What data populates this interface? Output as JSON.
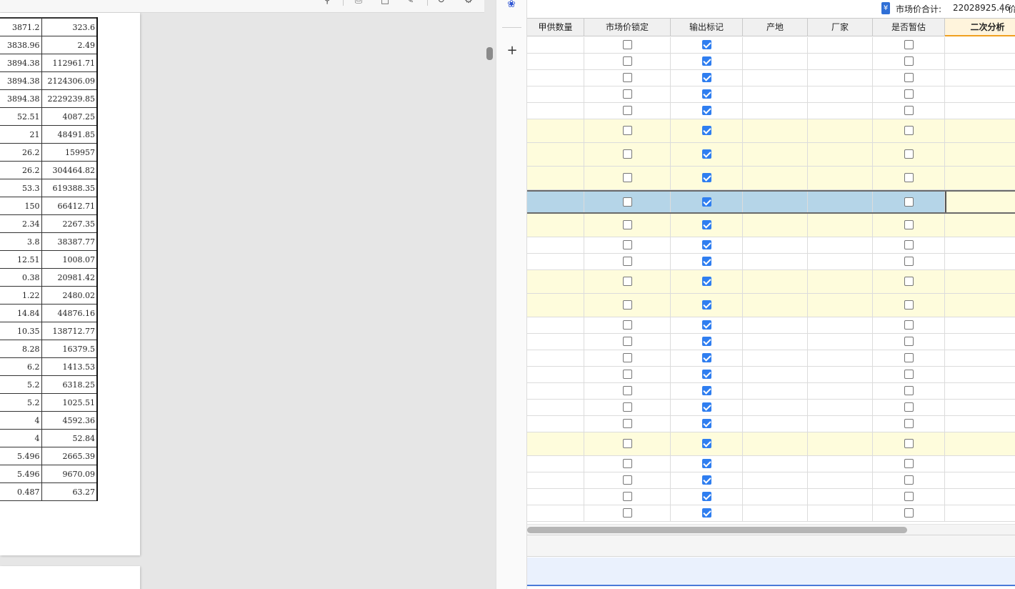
{
  "pdf_viewer": {
    "toolbar_icons": [
      "search-icon",
      "print-icon",
      "page-icon",
      "edit-icon",
      "rotate-icon",
      "settings-icon"
    ],
    "table_rows": [
      [
        "3871.2",
        "323.6"
      ],
      [
        "3838.96",
        "2.49"
      ],
      [
        "3894.38",
        "112961.71"
      ],
      [
        "3894.38",
        "2124306.09"
      ],
      [
        "3894.38",
        "2229239.85"
      ],
      [
        "52.51",
        "4087.25"
      ],
      [
        "21",
        "48491.85"
      ],
      [
        "26.2",
        "159957"
      ],
      [
        "26.2",
        "304464.82"
      ],
      [
        "53.3",
        "619388.35"
      ],
      [
        "150",
        "66412.71"
      ],
      [
        "2.34",
        "2267.35"
      ],
      [
        "3.8",
        "38387.77"
      ],
      [
        "12.51",
        "1008.07"
      ],
      [
        "0.38",
        "20981.42"
      ],
      [
        "1.22",
        "2480.02"
      ],
      [
        "14.84",
        "44876.16"
      ],
      [
        "10.35",
        "138712.77"
      ],
      [
        "8.28",
        "16379.5"
      ],
      [
        "6.2",
        "1413.53"
      ],
      [
        "5.2",
        "6318.25"
      ],
      [
        "5.2",
        "1025.51"
      ],
      [
        "4",
        "4592.36"
      ],
      [
        "4",
        "52.84"
      ],
      [
        "5.496",
        "2665.39"
      ],
      [
        "5.496",
        "9670.09"
      ],
      [
        "0.487",
        "63.27"
      ]
    ]
  },
  "rail": {
    "logo_icon": "paw-icon",
    "add_icon": "plus-icon",
    "add_label": "+"
  },
  "status": {
    "total_label": "市场价合计:",
    "total_value": "22028925.46",
    "next_label": "价",
    "currency_icon": "¥"
  },
  "grid": {
    "columns": [
      {
        "key": "jiagong_qty",
        "label": "甲供数量"
      },
      {
        "key": "price_lock",
        "label": "市场价锁定"
      },
      {
        "key": "output_flag",
        "label": "输出标记"
      },
      {
        "key": "origin",
        "label": "产地"
      },
      {
        "key": "manufacturer",
        "label": "厂家"
      },
      {
        "key": "provisional",
        "label": "是否暂估"
      },
      {
        "key": "secondary",
        "label": "二次分析"
      }
    ],
    "active_column": "二次分析",
    "rows": [
      {
        "style": "white",
        "price_lock": false,
        "output_flag": true,
        "provisional": false
      },
      {
        "style": "white",
        "price_lock": false,
        "output_flag": true,
        "provisional": false
      },
      {
        "style": "white",
        "price_lock": false,
        "output_flag": true,
        "provisional": false
      },
      {
        "style": "white",
        "price_lock": false,
        "output_flag": true,
        "provisional": false
      },
      {
        "style": "white",
        "price_lock": false,
        "output_flag": true,
        "provisional": false
      },
      {
        "style": "yellow",
        "price_lock": false,
        "output_flag": true,
        "provisional": false
      },
      {
        "style": "yellow",
        "price_lock": false,
        "output_flag": true,
        "provisional": false
      },
      {
        "style": "yellow",
        "price_lock": false,
        "output_flag": true,
        "provisional": false
      },
      {
        "style": "selected",
        "price_lock": false,
        "output_flag": true,
        "provisional": false
      },
      {
        "style": "yellow",
        "price_lock": false,
        "output_flag": true,
        "provisional": false
      },
      {
        "style": "white",
        "price_lock": false,
        "output_flag": true,
        "provisional": false
      },
      {
        "style": "white",
        "price_lock": false,
        "output_flag": true,
        "provisional": false
      },
      {
        "style": "yellow",
        "price_lock": false,
        "output_flag": true,
        "provisional": false
      },
      {
        "style": "yellow",
        "price_lock": false,
        "output_flag": true,
        "provisional": false
      },
      {
        "style": "white",
        "price_lock": false,
        "output_flag": true,
        "provisional": false
      },
      {
        "style": "white",
        "price_lock": false,
        "output_flag": true,
        "provisional": false
      },
      {
        "style": "white",
        "price_lock": false,
        "output_flag": true,
        "provisional": false
      },
      {
        "style": "white",
        "price_lock": false,
        "output_flag": true,
        "provisional": false
      },
      {
        "style": "white",
        "price_lock": false,
        "output_flag": true,
        "provisional": false
      },
      {
        "style": "white",
        "price_lock": false,
        "output_flag": true,
        "provisional": false
      },
      {
        "style": "white",
        "price_lock": false,
        "output_flag": true,
        "provisional": false
      },
      {
        "style": "yellow",
        "price_lock": false,
        "output_flag": true,
        "provisional": false
      },
      {
        "style": "white",
        "price_lock": false,
        "output_flag": true,
        "provisional": false
      },
      {
        "style": "white",
        "price_lock": false,
        "output_flag": true,
        "provisional": false
      },
      {
        "style": "white",
        "price_lock": false,
        "output_flag": true,
        "provisional": false
      },
      {
        "style": "white",
        "price_lock": false,
        "output_flag": true,
        "provisional": false
      }
    ]
  },
  "colors": {
    "checked": "#2f7ef0",
    "row_highlight": "#fefcdc",
    "row_selected": "#b5d5e8",
    "active_header_accent": "#f0a020",
    "footer_panel": "#eaf1fd"
  }
}
